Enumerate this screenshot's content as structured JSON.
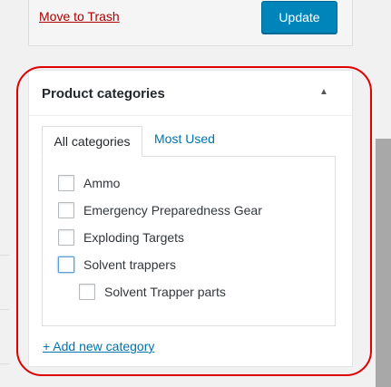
{
  "publish": {
    "trash_label": "Move to Trash",
    "update_label": "Update"
  },
  "categories_box": {
    "title": "Product categories",
    "toggle_icon": "arrow-up-icon",
    "tabs": [
      {
        "label": "All categories",
        "active": true
      },
      {
        "label": "Most Used",
        "active": false
      }
    ],
    "items": [
      {
        "label": "Ammo",
        "checked": false,
        "level": 0
      },
      {
        "label": "Emergency Preparedness Gear",
        "checked": false,
        "level": 0
      },
      {
        "label": "Exploding Targets",
        "checked": false,
        "level": 0
      },
      {
        "label": "Solvent trappers",
        "checked": false,
        "level": 0,
        "focused": true
      },
      {
        "label": "Solvent Trapper parts",
        "checked": false,
        "level": 1
      }
    ],
    "add_link": "+ Add new category"
  },
  "colors": {
    "primary": "#0085ba",
    "link": "#0073aa",
    "trash": "#a00000",
    "annotation": "#e00000"
  }
}
